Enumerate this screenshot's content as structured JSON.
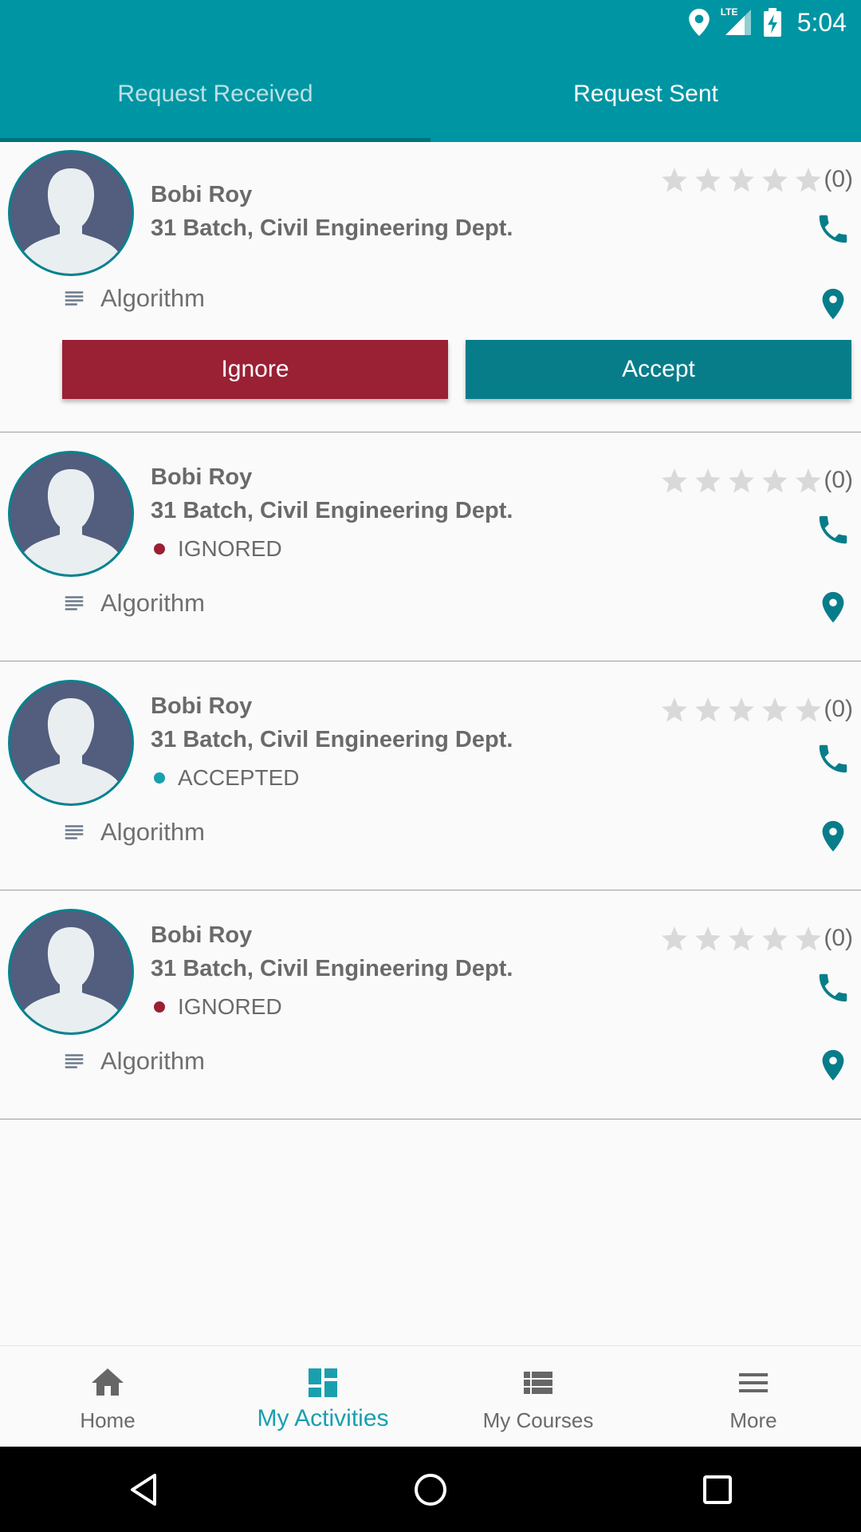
{
  "status_bar": {
    "network": "LTE",
    "time": "5:04",
    "icons": [
      "location-icon",
      "signal-icon",
      "battery-charging-icon"
    ]
  },
  "tabs": [
    {
      "label": "Request Received",
      "selected": true
    },
    {
      "label": "Request Sent",
      "selected": false
    }
  ],
  "colors": {
    "primary": "#0095a3",
    "accent": "#087d8a",
    "ignore": "#9a2034",
    "accepted_dot": "#1a9fae",
    "ignored_dot": "#9a2034"
  },
  "requests": [
    {
      "name": "Bobi Roy",
      "dept": "31 Batch, Civil Engineering Dept.",
      "rating_count": "(0)",
      "rating_value": 0,
      "topic": "Algorithm",
      "status": "",
      "actions": {
        "ignore": "Ignore",
        "accept": "Accept"
      }
    },
    {
      "name": "Bobi Roy",
      "dept": "31 Batch, Civil Engineering Dept.",
      "rating_count": "(0)",
      "rating_value": 0,
      "topic": "Algorithm",
      "status": "IGNORED"
    },
    {
      "name": "Bobi Roy",
      "dept": "31 Batch, Civil Engineering Dept.",
      "rating_count": "(0)",
      "rating_value": 0,
      "topic": "Algorithm",
      "status": "ACCEPTED"
    },
    {
      "name": "Bobi Roy",
      "dept": "31 Batch, Civil Engineering Dept.",
      "rating_count": "(0)",
      "rating_value": 0,
      "topic": "Algorithm",
      "status": "IGNORED"
    }
  ],
  "bottom_nav": [
    {
      "label": "Home",
      "icon": "home-icon",
      "active": false
    },
    {
      "label": "My Activities",
      "icon": "dashboard-icon",
      "active": true
    },
    {
      "label": "My Courses",
      "icon": "list-icon",
      "active": false
    },
    {
      "label": "More",
      "icon": "menu-icon",
      "active": false
    }
  ],
  "system_nav": [
    "back-icon",
    "home-circle-icon",
    "recents-icon"
  ]
}
